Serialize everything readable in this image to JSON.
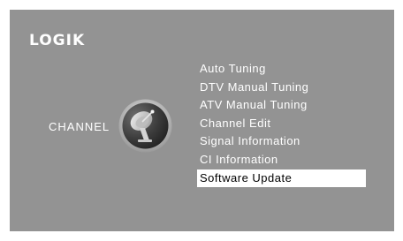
{
  "brand": {
    "logo_text": "LOGIK"
  },
  "section": {
    "label": "CHANNEL",
    "icon": "satellite-dish-icon"
  },
  "menu": {
    "items": [
      {
        "label": "Auto Tuning",
        "selected": false
      },
      {
        "label": "DTV Manual Tuning",
        "selected": false
      },
      {
        "label": "ATV Manual Tuning",
        "selected": false
      },
      {
        "label": "Channel Edit",
        "selected": false
      },
      {
        "label": "Signal Information",
        "selected": false
      },
      {
        "label": "CI Information",
        "selected": false
      },
      {
        "label": "Software Update",
        "selected": true
      }
    ]
  },
  "colors": {
    "background": "#939393",
    "text": "#ffffff",
    "highlight": "#ffffff",
    "highlight_text": "#000000"
  }
}
